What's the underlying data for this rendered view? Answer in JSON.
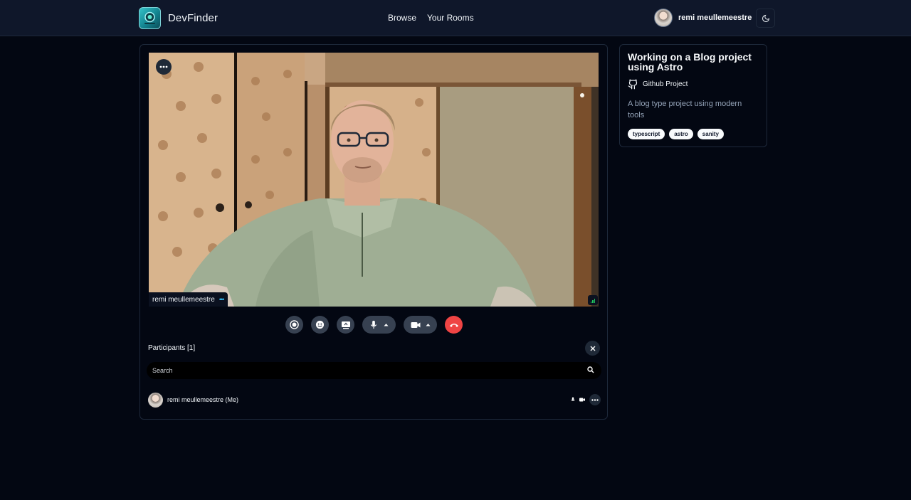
{
  "header": {
    "brand": "DevFinder",
    "nav": [
      "Browse",
      "Your Rooms"
    ],
    "user_name": "remi meullemeestre",
    "theme_icon": "moon-icon"
  },
  "video": {
    "participant_label": "remi meullemeestre",
    "more_icon": "more-horizontal-icon",
    "signal_icon": "signal-strength-icon"
  },
  "controls": {
    "record_icon": "record-icon",
    "reactions_icon": "emoji-icon",
    "screenshare_icon": "screen-share-icon",
    "mic_icon": "microphone-icon",
    "camera_icon": "video-camera-icon",
    "leave_icon": "phone-hangup-icon"
  },
  "participants": {
    "title": "Participants [1]",
    "search_placeholder": "Search",
    "list": [
      {
        "name": "remi meullemeestre (Me)"
      }
    ]
  },
  "room": {
    "title": "Working on a Blog project using Astro",
    "github_label": "Github Project",
    "description": "A blog type project using modern tools",
    "tags": [
      "typescript",
      "astro",
      "sanity"
    ]
  }
}
